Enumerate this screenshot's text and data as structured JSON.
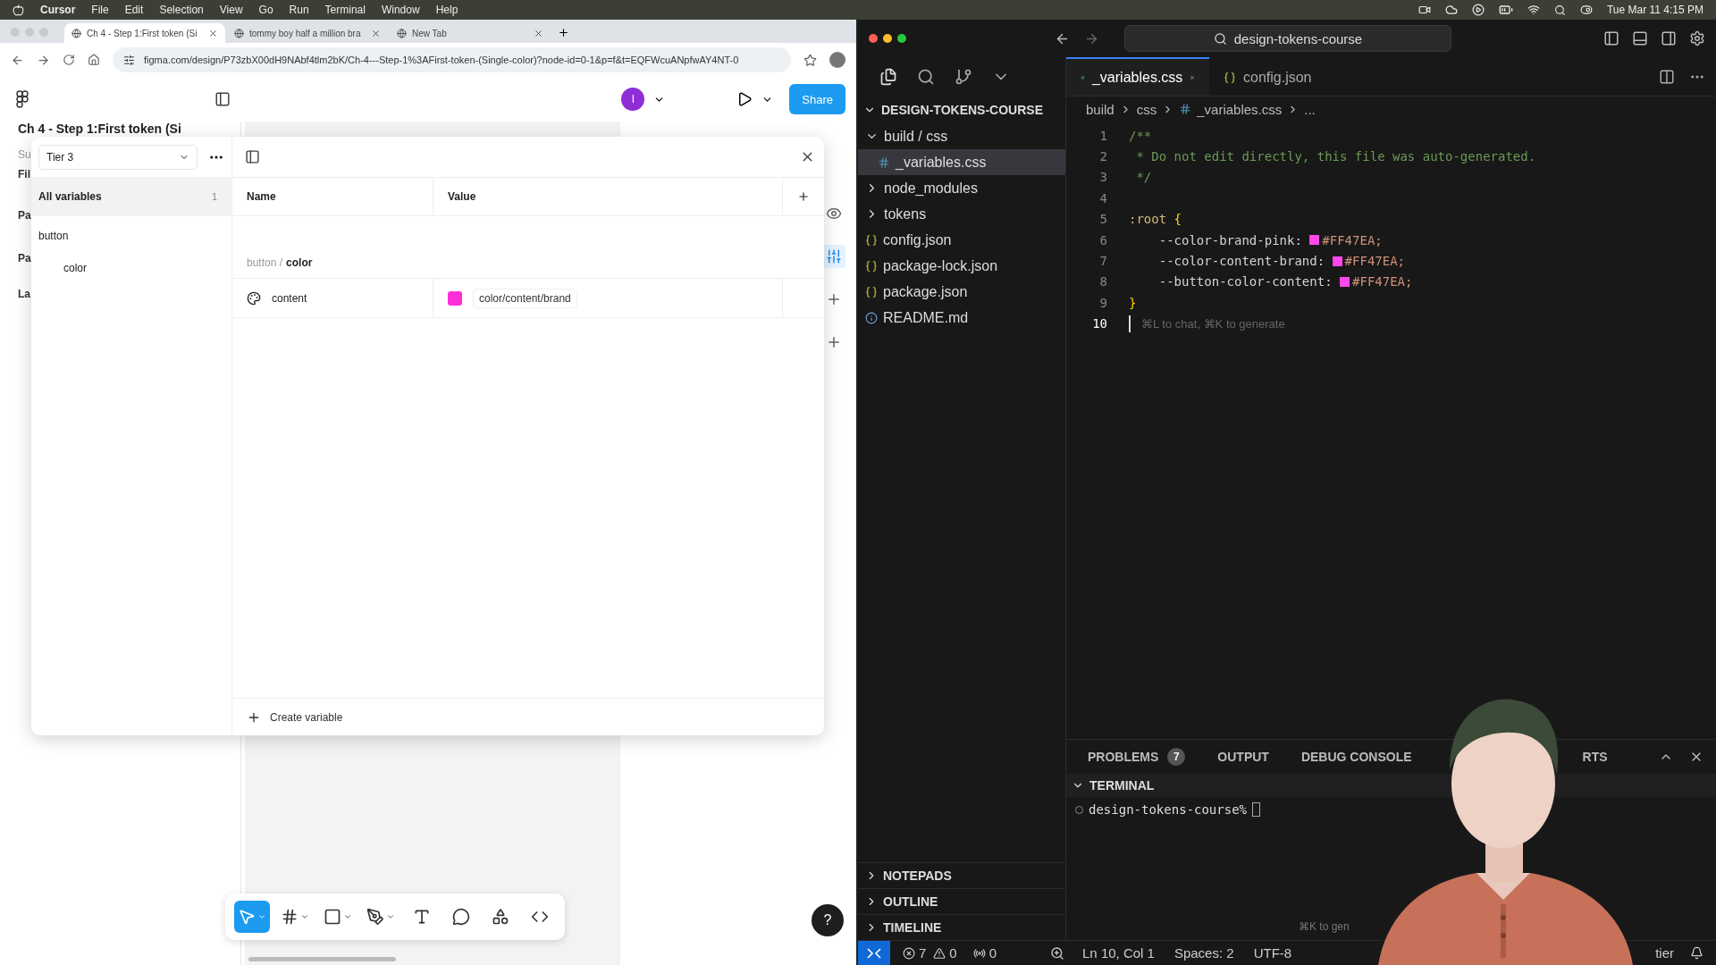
{
  "menu_bar": {
    "app": "Cursor",
    "items": [
      "File",
      "Edit",
      "Selection",
      "View",
      "Go",
      "Run",
      "Terminal",
      "Window",
      "Help"
    ],
    "clock": "Tue Mar 11  4:15 PM"
  },
  "browser": {
    "tabs": [
      {
        "title": "Ch 4 - Step 1:First token (Si",
        "selected": true
      },
      {
        "title": "tommy boy half a million bra",
        "selected": false
      },
      {
        "title": "New Tab",
        "selected": false
      }
    ],
    "url": "figma.com/design/P73zbX00dH9NAbf4tlm2bK/Ch-4---Step-1%3AFirst-token-(Single-color)?node-id=0-1&p=f&t=EQFWcuANpfwAY4NT-0"
  },
  "figma": {
    "file_title": "Ch 4 - Step 1:First token (Si",
    "avatar": "I",
    "share": "Share",
    "left_labels": [
      "Su",
      "Fil",
      "Pa",
      "Pa",
      "La"
    ],
    "variables": {
      "collection": "Tier 3",
      "groups": [
        {
          "label": "All variables",
          "count": "1",
          "selected": true
        },
        {
          "label": "button",
          "selected": false,
          "children": [
            {
              "label": "color",
              "selected": false
            }
          ]
        }
      ],
      "columns": [
        "Name",
        "Value"
      ],
      "group_path": {
        "parent": "button",
        "separator": "/",
        "name": "color"
      },
      "rows": [
        {
          "name": "content",
          "value": "color/content/brand",
          "color": "#ff2fd8"
        }
      ],
      "create": "Create variable"
    },
    "tools": [
      {
        "kind": "move",
        "selected": true,
        "menu": true
      },
      {
        "kind": "frame",
        "selected": false,
        "menu": true
      },
      {
        "kind": "shape",
        "selected": false,
        "menu": true
      },
      {
        "kind": "pen",
        "selected": false,
        "menu": true
      },
      {
        "kind": "text",
        "selected": false,
        "menu": false
      },
      {
        "kind": "comment",
        "selected": false,
        "menu": false
      },
      {
        "kind": "assets",
        "selected": false,
        "menu": false
      },
      {
        "kind": "code",
        "selected": false,
        "menu": false
      }
    ],
    "help": "?"
  },
  "editor": {
    "search": "design-tokens-course",
    "tabs": [
      {
        "label": "_variables.css",
        "kind": "css",
        "selected": true
      },
      {
        "label": "config.json",
        "kind": "json",
        "selected": false
      }
    ],
    "explorer": {
      "title": "DESIGN-TOKENS-COURSE",
      "items": [
        {
          "label": "build / css",
          "kind": "folder",
          "expanded": true,
          "selected": false,
          "children": [
            {
              "label": "_variables.css",
              "kind": "css",
              "selected": true
            }
          ]
        },
        {
          "label": "node_modules",
          "kind": "folder",
          "expanded": false,
          "selected": false
        },
        {
          "label": "tokens",
          "kind": "folder",
          "expanded": false,
          "selected": false
        },
        {
          "label": "config.json",
          "kind": "json",
          "selected": false
        },
        {
          "label": "package-lock.json",
          "kind": "json",
          "selected": false
        },
        {
          "label": "package.json",
          "kind": "json",
          "selected": false
        },
        {
          "label": "README.md",
          "kind": "info",
          "selected": false
        }
      ]
    },
    "sections": [
      "NOTEPADS",
      "OUTLINE",
      "TIMELINE"
    ],
    "breadcrumb": [
      "build",
      "css",
      "_variables.css",
      "..."
    ],
    "lines": [
      {
        "number": "1",
        "kind": "comment",
        "text": "/**",
        "current": false
      },
      {
        "number": "2",
        "kind": "comment",
        "text": " * Do not edit directly, this file was auto-generated.",
        "current": false
      },
      {
        "number": "3",
        "kind": "comment",
        "text": " */",
        "current": false
      },
      {
        "number": "4",
        "kind": "blank",
        "current": false
      },
      {
        "number": "5",
        "kind": "rule",
        "selector": ":root",
        "brace": "{",
        "current": false
      },
      {
        "number": "6",
        "kind": "decl",
        "property": "--color-brand-pink:",
        "value": "#FF47EA;",
        "color": "#ff47ea",
        "current": false
      },
      {
        "number": "7",
        "kind": "decl",
        "property": "--color-content-brand:",
        "value": "#FF47EA;",
        "color": "#ff47ea",
        "current": false
      },
      {
        "number": "8",
        "kind": "decl",
        "property": "--button-color-content:",
        "value": "#FF47EA;",
        "color": "#ff47ea",
        "current": false
      },
      {
        "number": "9",
        "kind": "close",
        "brace": "}",
        "current": false
      },
      {
        "number": "10",
        "kind": "hint",
        "text": "⌘L to chat, ⌘K to generate",
        "current": true
      }
    ],
    "panel_tabs": [
      {
        "label": "PROBLEMS",
        "badge": "7"
      },
      {
        "label": "OUTPUT"
      },
      {
        "label": "DEBUG CONSOLE"
      },
      {
        "label": "RTS"
      }
    ],
    "terminal": {
      "title": "TERMINAL",
      "prompt": "design-tokens-course%",
      "hint": "⌘K to gen"
    },
    "status": {
      "errors": "7",
      "warnings": "0",
      "ports": "0",
      "position": "Ln 10, Col 1",
      "spaces": "Spaces: 2",
      "encoding": "UTF-8",
      "formatter": "tier"
    }
  }
}
